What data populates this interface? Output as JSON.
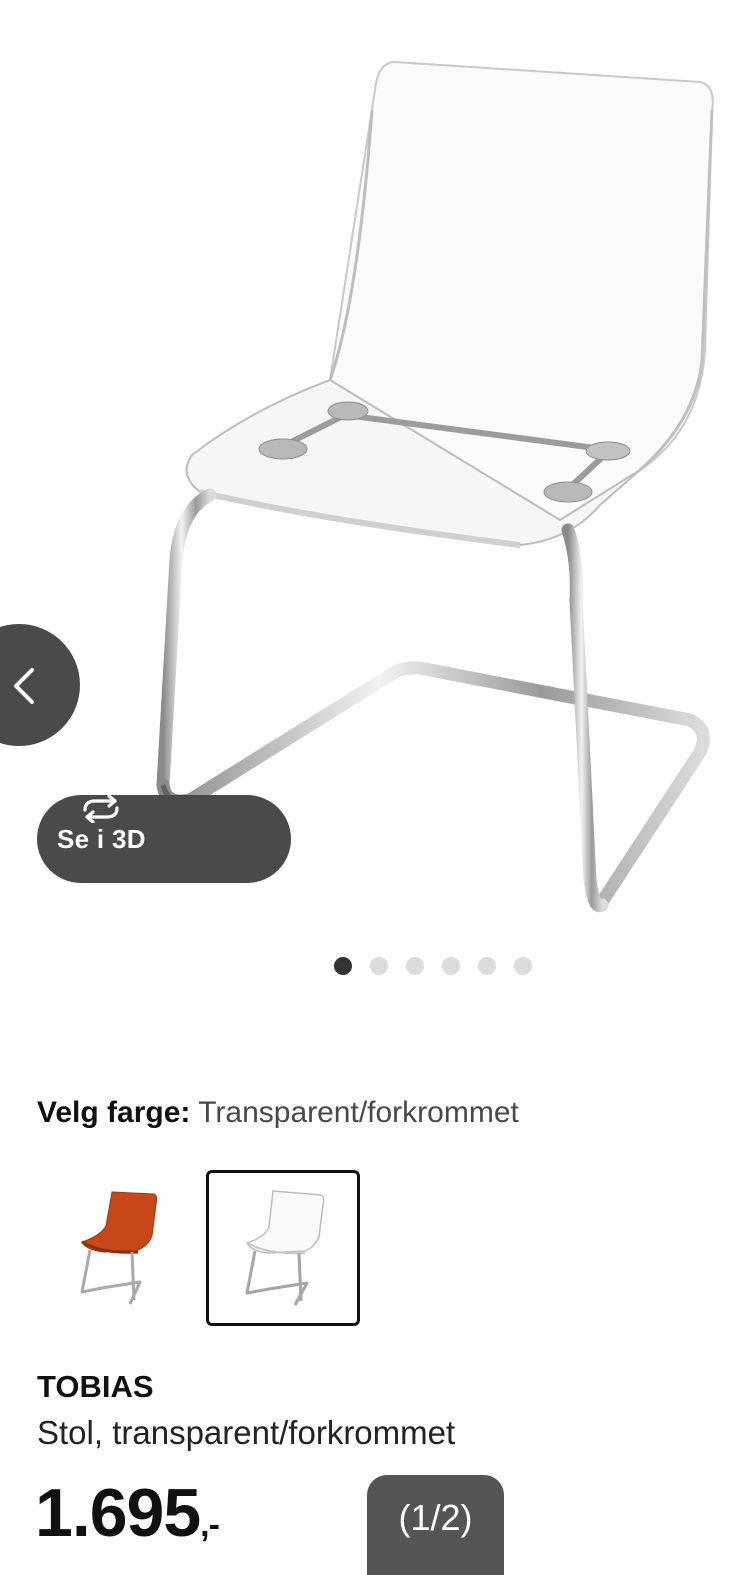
{
  "gallery": {
    "prev_icon": "chevron-left-icon",
    "view3d_label": "Se i 3D",
    "view3d_icon": "rotate-3d-icon",
    "dots": [
      true,
      false,
      false,
      false,
      false,
      false
    ]
  },
  "color": {
    "label": "Velg farge:",
    "value": "Transparent/forkrommet",
    "options": [
      {
        "name": "orange-red-chair",
        "color": "#c8471a",
        "selected": false
      },
      {
        "name": "transparent-chair",
        "color": "#eeeeee",
        "selected": true
      }
    ]
  },
  "product": {
    "name": "TOBIAS",
    "description": "Stol, transparent/forkrommet",
    "price_main": "1.695",
    "price_suffix": ",-"
  },
  "pager": {
    "label": "(1/2)"
  }
}
